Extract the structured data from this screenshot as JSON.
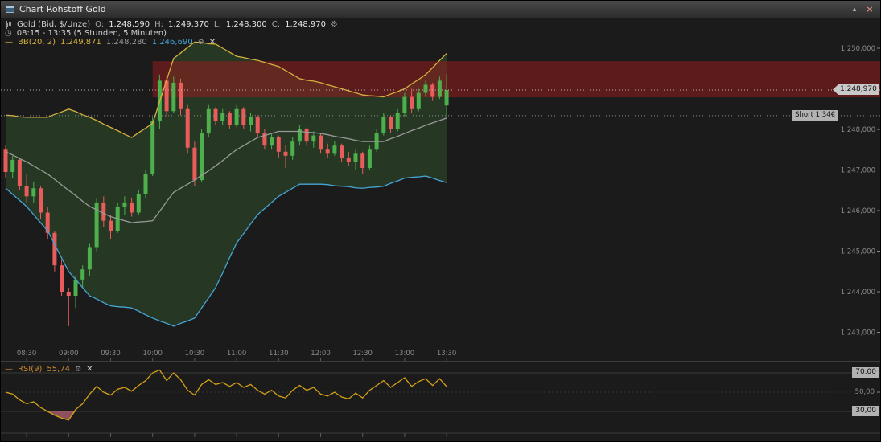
{
  "titlebar": {
    "title": "Chart Rohstoff Gold"
  },
  "header": {
    "instrument": "Gold (Bid, $/Unze)",
    "ohlc": [
      {
        "label": "O:",
        "value": "1.248,590"
      },
      {
        "label": "H:",
        "value": "1.249,370"
      },
      {
        "label": "L:",
        "value": "1.248,300"
      },
      {
        "label": "C:",
        "value": "1.248,970"
      }
    ],
    "timeframe": "08:15 - 13:35 (5 Stunden, 5 Minuten)",
    "bb_label": "BB(20, 2)",
    "bb_upper": "1.249,871",
    "bb_middle": "1.248,280",
    "bb_lower": "1.246,690"
  },
  "rsi_header": {
    "label": "RSI(9)",
    "value": "55,74"
  },
  "price_marker": {
    "text": "1.248,970",
    "value": 1248.97
  },
  "position_marker": {
    "text": "Short 1,34€",
    "value": 1248.34
  },
  "price_axis": {
    "ticks": [
      {
        "label": "1.250,000",
        "value": 1250
      },
      {
        "label": "1.248,000",
        "value": 1248
      },
      {
        "label": "1.247,000",
        "value": 1247
      },
      {
        "label": "1.246,000",
        "value": 1246
      },
      {
        "label": "1.245,000",
        "value": 1245
      },
      {
        "label": "1.244,000",
        "value": 1244
      },
      {
        "label": "1.243,000",
        "value": 1243
      }
    ]
  },
  "time_axis": {
    "labels": [
      "08:30",
      "09:00",
      "09:30",
      "10:00",
      "10:30",
      "11:00",
      "11:30",
      "12:00",
      "12:30",
      "13:00",
      "13:30"
    ]
  },
  "rsi_axis": {
    "levels": [
      {
        "label": "70,00",
        "value": 70,
        "boxed": true
      },
      {
        "label": "50,00",
        "value": 50,
        "boxed": false
      },
      {
        "label": "30,00",
        "value": 30,
        "boxed": true
      }
    ]
  },
  "colors": {
    "candle_up": "#4db04d",
    "candle_down": "#e85c5c",
    "bb_upper": "#d4b13f",
    "bb_middle": "#9a9a9a",
    "bb_lower": "#45a5d5",
    "bb_fill": "rgba(70,130,60,0.28)",
    "zone": "rgba(160,28,28,0.5)",
    "rsi_line": "#d4a017",
    "rsi_oversold": "rgba(235,125,145,0.55)",
    "axis_text": "#8a8a8a",
    "marker_bg": "#c4c4c4"
  },
  "chart_data": {
    "type": "candlestick",
    "title": "Gold (Bid, $/Unze)",
    "interval_minutes": 5,
    "x_start": "08:15",
    "x_end": "13:35",
    "ylim": [
      1242.4,
      1250.2
    ],
    "ohlc": [
      [
        1247.5,
        1247.6,
        1246.8,
        1246.95
      ],
      [
        1246.95,
        1247.35,
        1246.8,
        1247.25
      ],
      [
        1247.25,
        1247.3,
        1246.5,
        1246.6
      ],
      [
        1246.6,
        1246.9,
        1246.2,
        1246.35
      ],
      [
        1246.35,
        1246.7,
        1246.2,
        1246.55
      ],
      [
        1246.55,
        1246.6,
        1245.8,
        1245.95
      ],
      [
        1245.95,
        1246.1,
        1245.3,
        1245.45
      ],
      [
        1245.45,
        1245.5,
        1244.5,
        1244.65
      ],
      [
        1244.65,
        1244.8,
        1243.9,
        1244.0
      ],
      [
        1244.0,
        1244.1,
        1243.15,
        1243.9
      ],
      [
        1243.9,
        1244.4,
        1243.6,
        1244.3
      ],
      [
        1244.3,
        1244.65,
        1244.1,
        1244.55
      ],
      [
        1244.55,
        1245.2,
        1244.4,
        1245.1
      ],
      [
        1245.1,
        1246.3,
        1245.0,
        1246.2
      ],
      [
        1246.2,
        1246.35,
        1245.6,
        1245.75
      ],
      [
        1245.75,
        1245.9,
        1245.3,
        1245.5
      ],
      [
        1245.5,
        1246.2,
        1245.45,
        1246.1
      ],
      [
        1246.1,
        1246.35,
        1245.9,
        1246.2
      ],
      [
        1246.2,
        1246.3,
        1245.85,
        1245.95
      ],
      [
        1245.95,
        1246.5,
        1245.9,
        1246.4
      ],
      [
        1246.4,
        1247.0,
        1246.3,
        1246.9
      ],
      [
        1246.9,
        1248.3,
        1246.85,
        1248.2
      ],
      [
        1248.2,
        1249.35,
        1248.0,
        1249.2
      ],
      [
        1249.2,
        1249.3,
        1248.3,
        1248.45
      ],
      [
        1248.45,
        1249.3,
        1248.4,
        1249.15
      ],
      [
        1249.15,
        1249.25,
        1248.35,
        1248.5
      ],
      [
        1248.5,
        1248.6,
        1247.4,
        1247.55
      ],
      [
        1247.55,
        1247.7,
        1246.6,
        1246.75
      ],
      [
        1246.75,
        1248.0,
        1246.7,
        1247.9
      ],
      [
        1247.9,
        1248.6,
        1247.8,
        1248.5
      ],
      [
        1248.5,
        1248.55,
        1248.1,
        1248.2
      ],
      [
        1248.2,
        1248.5,
        1248.1,
        1248.4
      ],
      [
        1248.4,
        1248.45,
        1248.0,
        1248.1
      ],
      [
        1248.1,
        1248.6,
        1248.05,
        1248.5
      ],
      [
        1248.5,
        1248.55,
        1248.0,
        1248.1
      ],
      [
        1248.1,
        1248.4,
        1247.95,
        1248.3
      ],
      [
        1248.3,
        1248.35,
        1247.8,
        1247.9
      ],
      [
        1247.9,
        1248.0,
        1247.5,
        1247.6
      ],
      [
        1247.6,
        1247.9,
        1247.5,
        1247.8
      ],
      [
        1247.8,
        1247.85,
        1247.3,
        1247.45
      ],
      [
        1247.45,
        1247.6,
        1247.05,
        1247.35
      ],
      [
        1247.35,
        1247.8,
        1247.25,
        1247.7
      ],
      [
        1247.7,
        1248.1,
        1247.6,
        1248.0
      ],
      [
        1248.0,
        1248.05,
        1247.6,
        1247.7
      ],
      [
        1247.7,
        1247.95,
        1247.55,
        1247.85
      ],
      [
        1247.85,
        1247.9,
        1247.4,
        1247.5
      ],
      [
        1247.5,
        1247.65,
        1247.3,
        1247.4
      ],
      [
        1247.4,
        1247.7,
        1247.35,
        1247.6
      ],
      [
        1247.6,
        1247.65,
        1247.2,
        1247.3
      ],
      [
        1247.3,
        1247.45,
        1247.1,
        1247.2
      ],
      [
        1247.2,
        1247.5,
        1247.0,
        1247.4
      ],
      [
        1247.4,
        1247.45,
        1246.9,
        1247.05
      ],
      [
        1247.05,
        1247.6,
        1247.0,
        1247.5
      ],
      [
        1247.5,
        1248.0,
        1247.45,
        1247.9
      ],
      [
        1247.9,
        1248.4,
        1247.85,
        1248.3
      ],
      [
        1248.3,
        1248.35,
        1247.9,
        1248.0
      ],
      [
        1248.0,
        1248.5,
        1247.95,
        1248.4
      ],
      [
        1248.4,
        1248.9,
        1248.3,
        1248.8
      ],
      [
        1248.8,
        1249.0,
        1248.4,
        1248.5
      ],
      [
        1248.5,
        1249.0,
        1248.45,
        1248.9
      ],
      [
        1248.9,
        1249.2,
        1248.8,
        1249.1
      ],
      [
        1249.1,
        1249.15,
        1248.7,
        1248.8
      ],
      [
        1248.8,
        1249.3,
        1248.75,
        1249.2
      ],
      [
        1248.59,
        1249.37,
        1248.3,
        1248.97
      ]
    ],
    "bollinger": {
      "period": 20,
      "deviation": 2,
      "middle": [
        1247.45,
        1247.37,
        1247.28,
        1247.2,
        1247.1,
        1247.0,
        1246.9,
        1246.77,
        1246.63,
        1246.5,
        1246.37,
        1246.23,
        1246.1,
        1246.02,
        1245.93,
        1245.85,
        1245.8,
        1245.75,
        1245.7,
        1245.72,
        1245.73,
        1245.75,
        1245.98,
        1246.22,
        1246.45,
        1246.55,
        1246.65,
        1246.75,
        1246.87,
        1246.98,
        1247.1,
        1247.23,
        1247.37,
        1247.5,
        1247.6,
        1247.7,
        1247.8,
        1247.85,
        1247.9,
        1247.95,
        1247.95,
        1247.95,
        1247.95,
        1247.93,
        1247.92,
        1247.9,
        1247.87,
        1247.83,
        1247.8,
        1247.77,
        1247.73,
        1247.7,
        1247.7,
        1247.7,
        1247.7,
        1247.77,
        1247.83,
        1247.9,
        1247.97,
        1248.03,
        1248.1,
        1248.16,
        1248.22,
        1248.28
      ],
      "half_width": [
        0.9,
        0.97,
        1.03,
        1.1,
        1.2,
        1.3,
        1.4,
        1.6,
        1.8,
        2.0,
        2.07,
        2.13,
        2.2,
        2.2,
        2.2,
        2.2,
        2.17,
        2.13,
        2.1,
        2.2,
        2.3,
        2.4,
        2.7,
        3.0,
        3.3,
        3.33,
        3.37,
        3.4,
        3.27,
        3.13,
        3.0,
        2.77,
        2.53,
        2.3,
        2.17,
        2.03,
        1.9,
        1.8,
        1.7,
        1.6,
        1.5,
        1.4,
        1.3,
        1.28,
        1.27,
        1.25,
        1.23,
        1.22,
        1.2,
        1.18,
        1.17,
        1.15,
        1.13,
        1.12,
        1.1,
        1.1,
        1.1,
        1.1,
        1.15,
        1.2,
        1.25,
        1.36,
        1.48,
        1.59
      ]
    },
    "rsi": {
      "period": 9,
      "overbought": 70,
      "oversold": 30,
      "last": 55.74,
      "values": [
        50,
        48,
        42,
        38,
        40,
        34,
        30,
        26,
        23,
        21,
        32,
        38,
        48,
        56,
        50,
        47,
        53,
        55,
        51,
        57,
        62,
        70,
        73,
        62,
        70,
        63,
        52,
        47,
        58,
        63,
        58,
        60,
        56,
        60,
        55,
        58,
        52,
        48,
        52,
        46,
        44,
        52,
        57,
        52,
        55,
        48,
        46,
        50,
        45,
        43,
        49,
        44,
        52,
        57,
        62,
        55,
        60,
        65,
        56,
        61,
        64,
        57,
        64,
        55.74
      ]
    },
    "zone": {
      "price_top": 1249.68,
      "price_bottom": 1248.79,
      "start_index": 21
    }
  }
}
